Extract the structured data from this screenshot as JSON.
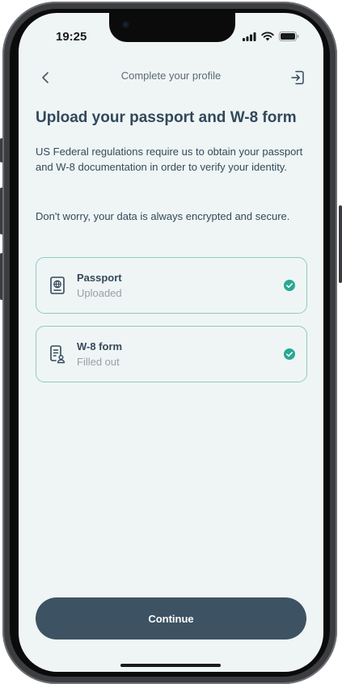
{
  "status_bar": {
    "time": "19:25"
  },
  "nav": {
    "title": "Complete your profile",
    "back_icon": "chevron-left-icon",
    "exit_icon": "exit-icon"
  },
  "page": {
    "heading": "Upload your passport and W-8 form",
    "description": "US Federal regulations require us to obtain your passport and W-8 documentation in order to verify your identity.",
    "note": "Don't worry, your data is always encrypted and secure."
  },
  "documents": [
    {
      "title": "Passport",
      "status": "Uploaded",
      "icon": "passport-icon",
      "complete": true
    },
    {
      "title": "W-8 form",
      "status": "Filled out",
      "icon": "form-person-icon",
      "complete": true
    }
  ],
  "continue_button": {
    "label": "Continue"
  },
  "colors": {
    "background": "#eff5f5",
    "accent": "#2aa893",
    "primary_dark": "#3d5263",
    "card_border": "#8fcac2"
  }
}
